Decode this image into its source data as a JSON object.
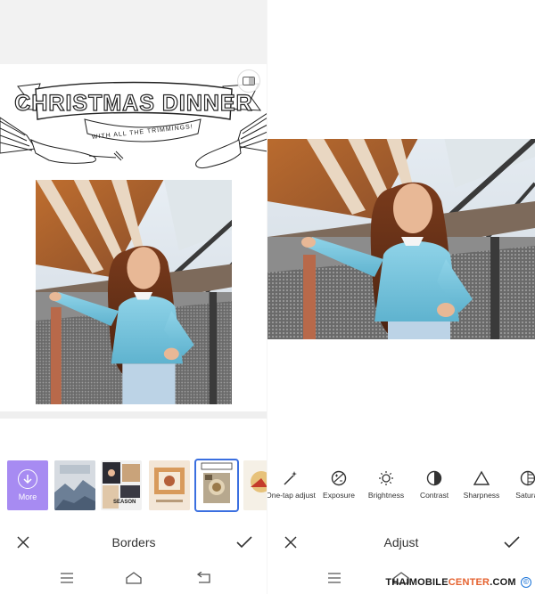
{
  "left_screen": {
    "banner": {
      "title": "CHRISTMAS DINNER",
      "subtitle": "WITH ALL THE TRIMMINGS!"
    },
    "thumbnails": [
      {
        "label": "More",
        "icon": "download-circle-icon",
        "color": "#a78bf2"
      },
      {
        "label": "",
        "icon": "mountain-card"
      },
      {
        "label": "SEASON",
        "icon": "season-card"
      },
      {
        "label": "",
        "icon": "photo-card-orange"
      },
      {
        "label": "",
        "icon": "christmas-card",
        "selected": true
      },
      {
        "label": "",
        "icon": "partial-card"
      }
    ],
    "bottom_bar": {
      "title": "Borders",
      "close_icon": "close-icon",
      "done_icon": "check-icon"
    }
  },
  "right_screen": {
    "tools": [
      {
        "label": "One-tap adjust",
        "icon": "magic-wand-icon"
      },
      {
        "label": "Exposure",
        "icon": "exposure-icon"
      },
      {
        "label": "Brightness",
        "icon": "sun-icon"
      },
      {
        "label": "Contrast",
        "icon": "contrast-icon"
      },
      {
        "label": "Sharpness",
        "icon": "triangle-icon"
      },
      {
        "label": "Saturat",
        "icon": "saturation-icon"
      }
    ],
    "bottom_bar": {
      "title": "Adjust",
      "close_icon": "close-icon",
      "done_icon": "check-icon"
    }
  },
  "nav": {
    "menu_icon": "menu-icon",
    "home_icon": "home-icon",
    "back_icon": "back-icon"
  },
  "watermark": {
    "part1": "THAIMOBILE",
    "part2": "CENTER",
    "part3": ".COM",
    "symbol": "©"
  },
  "colors": {
    "accent_selected": "#3a6fe0",
    "more_tile": "#a78bf2",
    "watermark_accent": "#e5612e"
  }
}
